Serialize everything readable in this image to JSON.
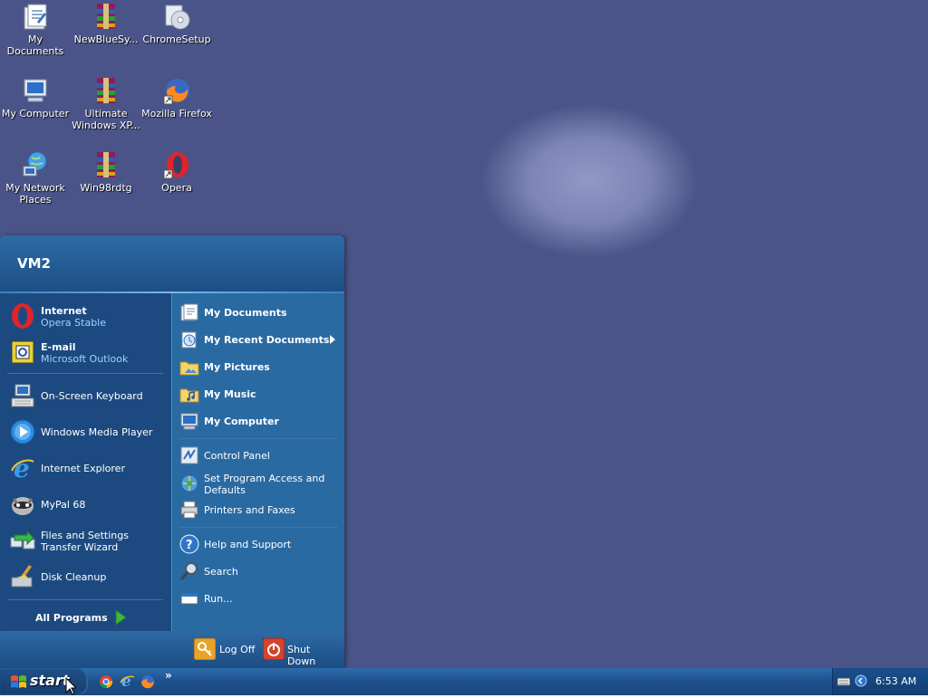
{
  "desktop": {
    "icons": [
      {
        "label": "My Documents"
      },
      {
        "label": "NewBlueSy..."
      },
      {
        "label": "ChromeSetup"
      },
      {
        "label": "My Computer"
      },
      {
        "label": "Ultimate Windows XP..."
      },
      {
        "label": "Mozilla Firefox"
      },
      {
        "label": "My Network Places"
      },
      {
        "label": "Win98rdtg"
      },
      {
        "label": "Opera"
      }
    ]
  },
  "start_menu": {
    "user": "VM2",
    "pinned": [
      {
        "title": "Internet",
        "subtitle": "Opera Stable"
      },
      {
        "title": "E-mail",
        "subtitle": "Microsoft Outlook"
      }
    ],
    "recent": [
      "On-Screen Keyboard",
      "Windows Media Player",
      "Internet Explorer",
      "MyPal 68",
      "Files and Settings Transfer Wizard",
      "Disk Cleanup"
    ],
    "all_programs": "All Programs",
    "right": [
      "My Documents",
      "My Recent Documents",
      "My Pictures",
      "My Music",
      "My Computer",
      "Control Panel",
      "Set Program Access and Defaults",
      "Printers and Faxes",
      "Help and Support",
      "Search",
      "Run..."
    ],
    "log_off": "Log Off",
    "shut_down": "Shut Down"
  },
  "taskbar": {
    "start_label": "start",
    "overflow": "»",
    "clock": "6:53 AM"
  },
  "colors": {
    "taskbar": "#1d4f8a",
    "menu_left": "#1c4a80",
    "menu_right": "#2a6aa3",
    "subtitle": "#9fd1ff"
  }
}
